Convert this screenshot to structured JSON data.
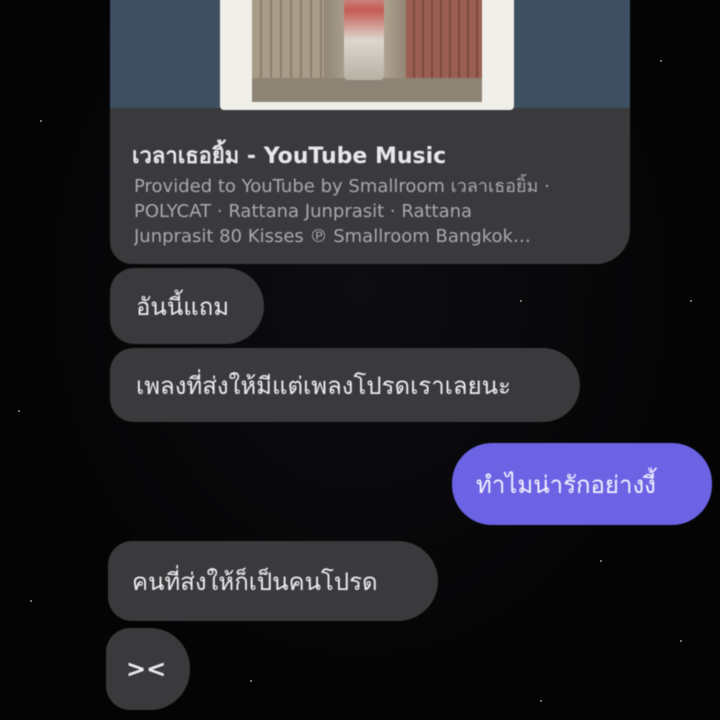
{
  "link_preview": {
    "title": "เวลาเธอยิ้ม - YouTube Music",
    "description_lines": [
      "Provided to YouTube by Smallroom เวลาเธอยิ้ม ·",
      "POLYCAT · Rattana Junprasit · Rattana",
      "Junprasit 80 Kisses ℗ Smallroom Bangkok…"
    ]
  },
  "messages": [
    {
      "side": "incoming",
      "text": "อันนี้แถม"
    },
    {
      "side": "incoming",
      "text": "เพลงที่ส่งให้มีแต่เพลงโปรดเราเลยนะ"
    },
    {
      "side": "outgoing",
      "text": "ทำไมน่ารักอย่างงี้"
    },
    {
      "side": "incoming",
      "text": "คนที่ส่งให้ก็เป็นคนโปรด"
    },
    {
      "side": "incoming",
      "text": "><"
    }
  ],
  "colors": {
    "background": "#050506",
    "incoming_bubble": "#3a3a3d",
    "outgoing_bubble": "#6b63e4",
    "preview_band": "#3d4f60"
  }
}
